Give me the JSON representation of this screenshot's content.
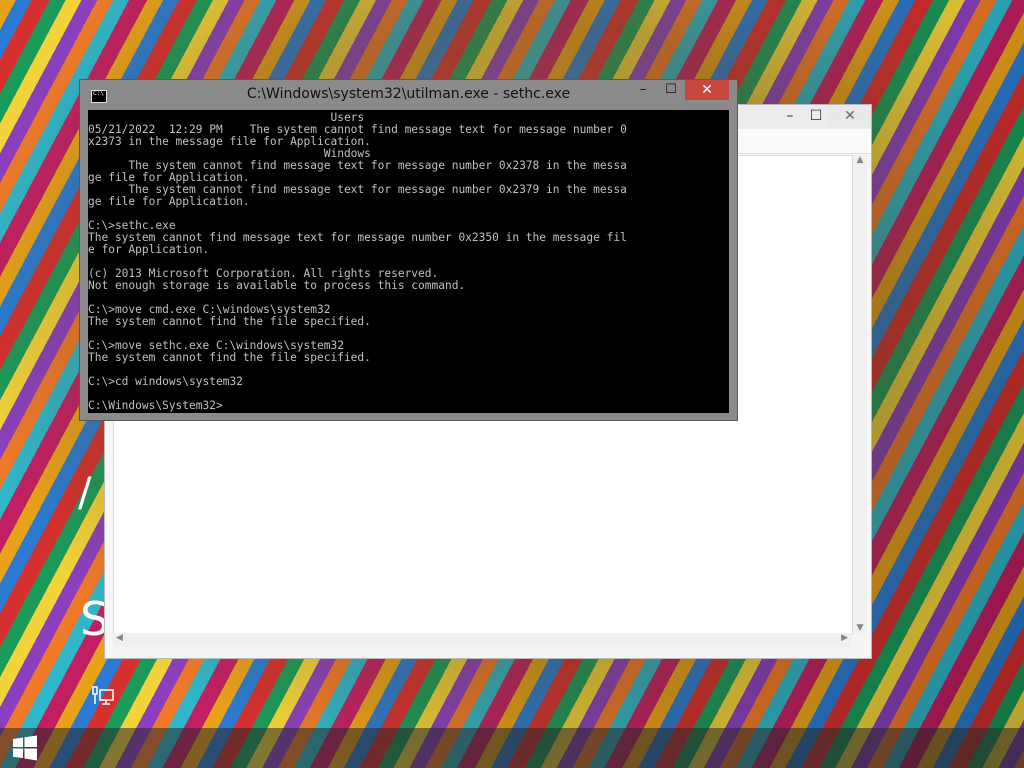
{
  "console": {
    "title": "C:\\Windows\\system32\\utilman.exe - sethc.exe",
    "controls": {
      "minimize": "–",
      "maximize": "☐",
      "close": "✕"
    },
    "lines": [
      "                                    Users",
      "05/21/2022  12:29 PM    The system cannot find message text for message number 0",
      "x2373 in the message file for Application.",
      "                                   Windows",
      "      The system cannot find message text for message number 0x2378 in the messa",
      "ge file for Application.",
      "      The system cannot find message text for message number 0x2379 in the messa",
      "ge file for Application.",
      "",
      "C:\\>sethc.exe",
      "The system cannot find message text for message number 0x2350 in the message fil",
      "e for Application.",
      "",
      "(c) 2013 Microsoft Corporation. All rights reserved.",
      "Not enough storage is available to process this command.",
      "",
      "C:\\>move cmd.exe C:\\windows\\system32",
      "The system cannot find the file specified.",
      "",
      "C:\\>move sethc.exe C:\\windows\\system32",
      "The system cannot find the file specified.",
      "",
      "C:\\>cd windows\\system32",
      "",
      "C:\\Windows\\System32>"
    ]
  },
  "background_window": {
    "controls": {
      "minimize": "–",
      "maximize": "☐",
      "close": "✕"
    }
  },
  "lockscreen": {
    "partial_glyph_top": "/",
    "partial_glyph_bottom": "S"
  },
  "icons": {
    "ease_of_access": "network-icon",
    "start": "windows-logo-icon"
  }
}
